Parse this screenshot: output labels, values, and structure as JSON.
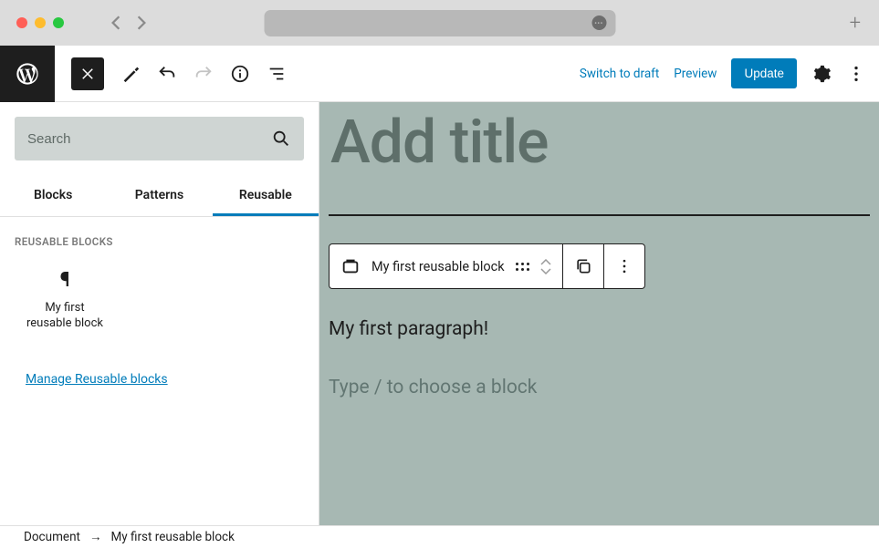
{
  "toolbar": {
    "switch_to_draft": "Switch to draft",
    "preview": "Preview",
    "update": "Update"
  },
  "sidebar": {
    "search_placeholder": "Search",
    "tabs": [
      "Blocks",
      "Patterns",
      "Reusable"
    ],
    "active_tab_index": 2,
    "section_label": "REUSABLE BLOCKS",
    "block_items": [
      {
        "label": "My first\nreusable block",
        "icon": "paragraph"
      }
    ],
    "manage_link": "Manage Reusable blocks"
  },
  "canvas": {
    "title_placeholder": "Add title",
    "block_toolbar_label": "My first reusable block",
    "paragraph_text": "My first paragraph!",
    "slash_hint": "Type / to choose a block"
  },
  "breadcrumb": {
    "root": "Document",
    "current": "My first reusable block"
  }
}
